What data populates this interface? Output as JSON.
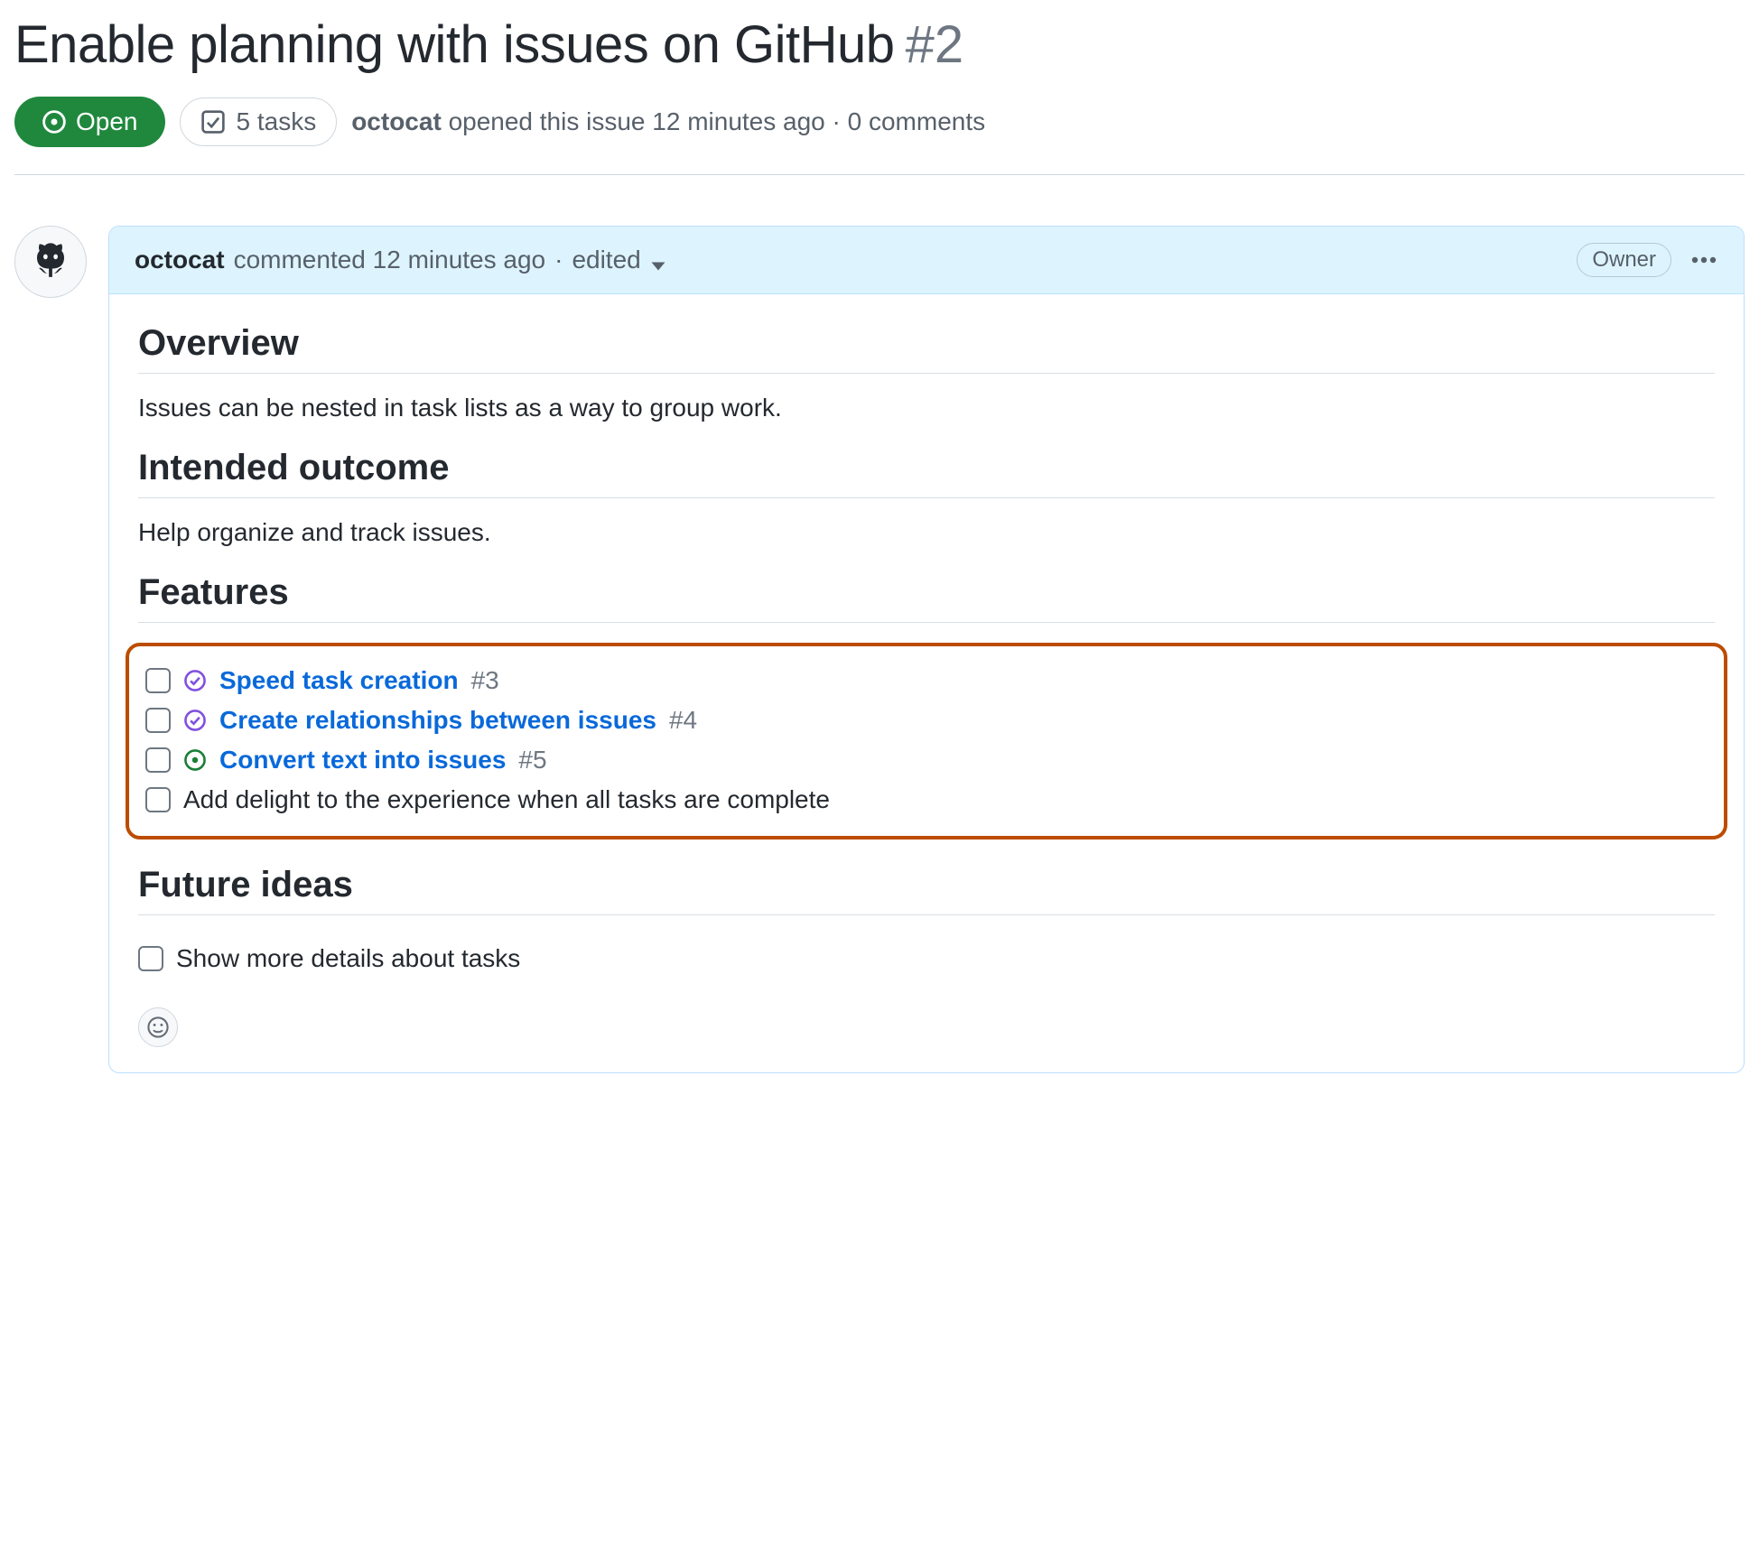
{
  "issue": {
    "title": "Enable planning with issues on GitHub",
    "number": "#2",
    "state": "Open",
    "tasks_badge": "5 tasks",
    "author": "octocat",
    "opened_text": "opened this issue 12 minutes ago",
    "separator": "·",
    "comments_text": "0 comments"
  },
  "comment": {
    "author": "octocat",
    "commented_text": "commented 12 minutes ago",
    "edited_label": "edited",
    "role_badge": "Owner",
    "headings": {
      "overview": "Overview",
      "intended": "Intended outcome",
      "features": "Features",
      "future": "Future ideas"
    },
    "overview_text": "Issues can be nested in task lists as a way to group work.",
    "intended_text": "Help organize and track issues.",
    "features_tasks": [
      {
        "status": "closed",
        "title": "Speed task creation",
        "ref": "#3"
      },
      {
        "status": "closed",
        "title": "Create relationships between issues",
        "ref": "#4"
      },
      {
        "status": "open",
        "title": "Convert text into issues",
        "ref": "#5"
      },
      {
        "status": "plain",
        "title": "Add delight to the experience when all tasks are complete",
        "ref": ""
      }
    ],
    "future_tasks": [
      {
        "status": "plain",
        "title": "Show more details about tasks",
        "ref": ""
      }
    ]
  }
}
